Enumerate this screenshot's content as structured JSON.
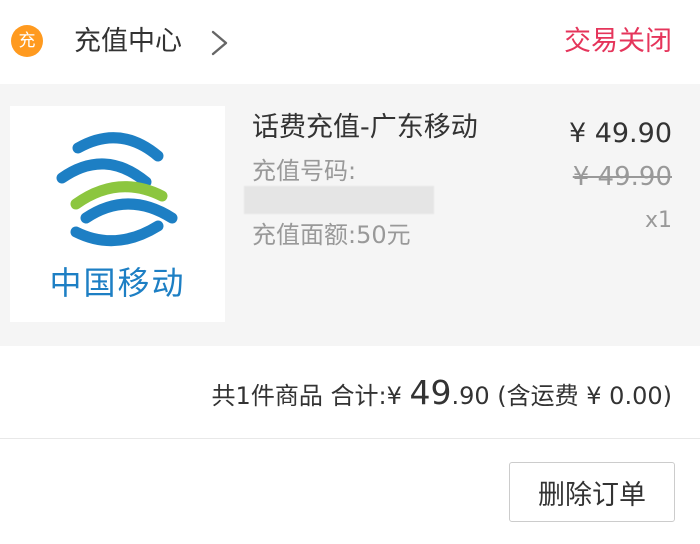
{
  "header": {
    "shop_badge": "充",
    "shop_name": "充值中心",
    "status": "交易关闭"
  },
  "item": {
    "logo_text": "中国移动",
    "title": "话费充值-广东移动",
    "phone_label": "充值号码:",
    "value_label": "充值面额:50元",
    "price": "¥ 49.90",
    "original_price": "¥ 49.90",
    "quantity": "x1"
  },
  "summary": {
    "count_text": "共1件商品",
    "total_label": "合计:",
    "currency": "¥",
    "amount_int": "49",
    "amount_dec": ".90",
    "shipping_text": "(含运费 ¥ 0.00)"
  },
  "actions": {
    "delete_label": "删除订单"
  },
  "colors": {
    "status": "#e5355b",
    "badge": "#ff9a1f",
    "brand_blue": "#1d7fc4",
    "brand_green": "#8cc63f"
  }
}
